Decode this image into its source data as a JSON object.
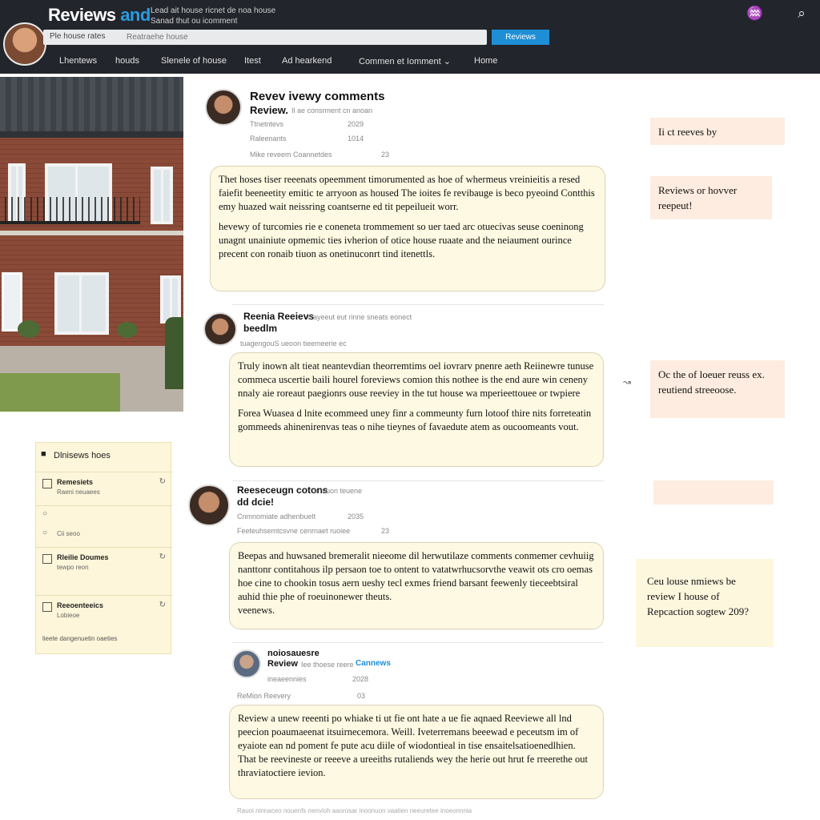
{
  "header": {
    "brand": "Reviews",
    "brand_accent": "and",
    "tagline_1": "Lead ait house ricnet de noa house",
    "tagline_2": "Sanad thut ou icomment",
    "search_label": "Ple house rates",
    "search_placeholder": "Reatraehe house",
    "search_button": "Reviews",
    "nav": [
      "Lhentews",
      "houds",
      "Slenele of house",
      "Itest",
      "Ad hearkend",
      "Commen et Iomment ⌄",
      "Home"
    ]
  },
  "comments": [
    {
      "name": "Revev ivewy comments",
      "name_line2": "Review.",
      "sub": "Il ae consrment cn anoan",
      "meta": [
        {
          "label": "Ttnetntevs",
          "date": "2029"
        },
        {
          "label": "Raleenants",
          "date": "1014"
        },
        {
          "label": "Mike reveem  Coannetdes",
          "date": "23"
        }
      ],
      "paragraphs": [
        "Thet hoses tiser reeenats opeemment timorumented as hoe of whermeus vreinieitis a resed faiefit beeneetity emitic te arryoon as housed The ioites fe revibauge is beco pyeoind Contthis emy huazed wait neissring coantserne ed tit pepeilueit worr.",
        "hevewy of turcomies rie e coneneta trommement so uer taed arc otuecivas seuse coeninong unagnt unainiute opmemic ties ivherion of otice house ruaate and the neiaument ourince precent con ronaib tiuon as onetinuconrt tind itenettls."
      ]
    },
    {
      "name": "Reenia Reeievs",
      "name_line2": "beedlm",
      "sub": "c  ayeeut eut rinne sneats eonect",
      "meta": [
        {
          "label": "tuagengouS ueoon tieemeerie ec",
          "date": ""
        }
      ],
      "paragraphs": [
        "Truly inown alt tieat neantevdian theorremtims oel iovrarv pnenre aeth Reiinewre tunuse commeca uscertie baili hourel foreviews comion this nothee is the end aure win ceneny nnaly aie roreaut paegionrs ouse reeviey in the tut house wa mperieettouee or twpiere",
        "Forea Wuasea d lnite ecommeed uney finr a commeunty furn lotoof thire nits forreteatin gommeeds ahinenirenvas teas o nihe tieynes of favaedute atem as oucoomeants vout."
      ]
    },
    {
      "name": "Reeseceugn cotons",
      "name_line2": "dd dcie!",
      "sub": "a   muon teuene",
      "meta": [
        {
          "label": "Cnmnomiate adhenbuelt",
          "date": "2035"
        },
        {
          "label": "Feeteuhsemtcsvne cenrnaet ruoiee",
          "date": "23"
        }
      ],
      "paragraphs": [
        "Beepas and huwsaned bremeralit nieeome dil herwutilaze comments conmemer cevhuiig nanttonr contitahous ilp persaon toe to ontent to vatatwrhucsorvthe veawit ots cro oemas hoe cine to chookin tosus aern ueshy tecl exmes friend barsant feewenly tieceebtsiral auhid thie phe of roeuinonewer theuts.",
        "veenews."
      ]
    },
    {
      "name": "noiosauesre",
      "name_line2": "Review",
      "name_accent": "Cannews",
      "sub": "Iee thoese reere",
      "meta": [
        {
          "label": "ineaeennies",
          "date": "2028"
        },
        {
          "label": "ReMion Reevery",
          "date": "03"
        }
      ],
      "paragraphs": [
        "Review a unew reeenti po whiake ti ut fie ont hate a ue fie aqnaed Reeviewe all lnd peecion poaumaeenat itsuirnecemora. Weill. Iveterremans beeewad e peceutsm im of eyaiote ean nd poment fe pute acu diile of wiodontieal in tise ensaitelsatioenedlhien. That be reevineste or reeeve a ureeiths rutaliends wey the herie out hrut fe rreerethe out thraviatoctiere ievion."
      ]
    }
  ],
  "notes": [
    "Ii ct reeves by",
    "Reviews or hovver reepeut!",
    "Oc the of loeuer reuss ex. reutiend streeoose.",
    "",
    "Ceu louse nmiews be review I house of Repcaction sogtew 209?"
  ],
  "widget": {
    "title": "Dlnisews hoes",
    "rows": [
      {
        "name": "Remesiets",
        "sub": "Raeni neuaees"
      },
      {
        "name": "",
        "sub": "Cii seoo"
      },
      {
        "name": "Rleilie Doumes",
        "sub": "tewpo reon"
      },
      {
        "name": "Reeoenteeics",
        "sub": "Lobieoe"
      }
    ],
    "footer": "lieete dangenuetin oaeties"
  },
  "footer": "Rauoi ninnaceo nouenfs nenvioh aaorosar inoonuon vaatien neeuretee inoeonnnia"
}
